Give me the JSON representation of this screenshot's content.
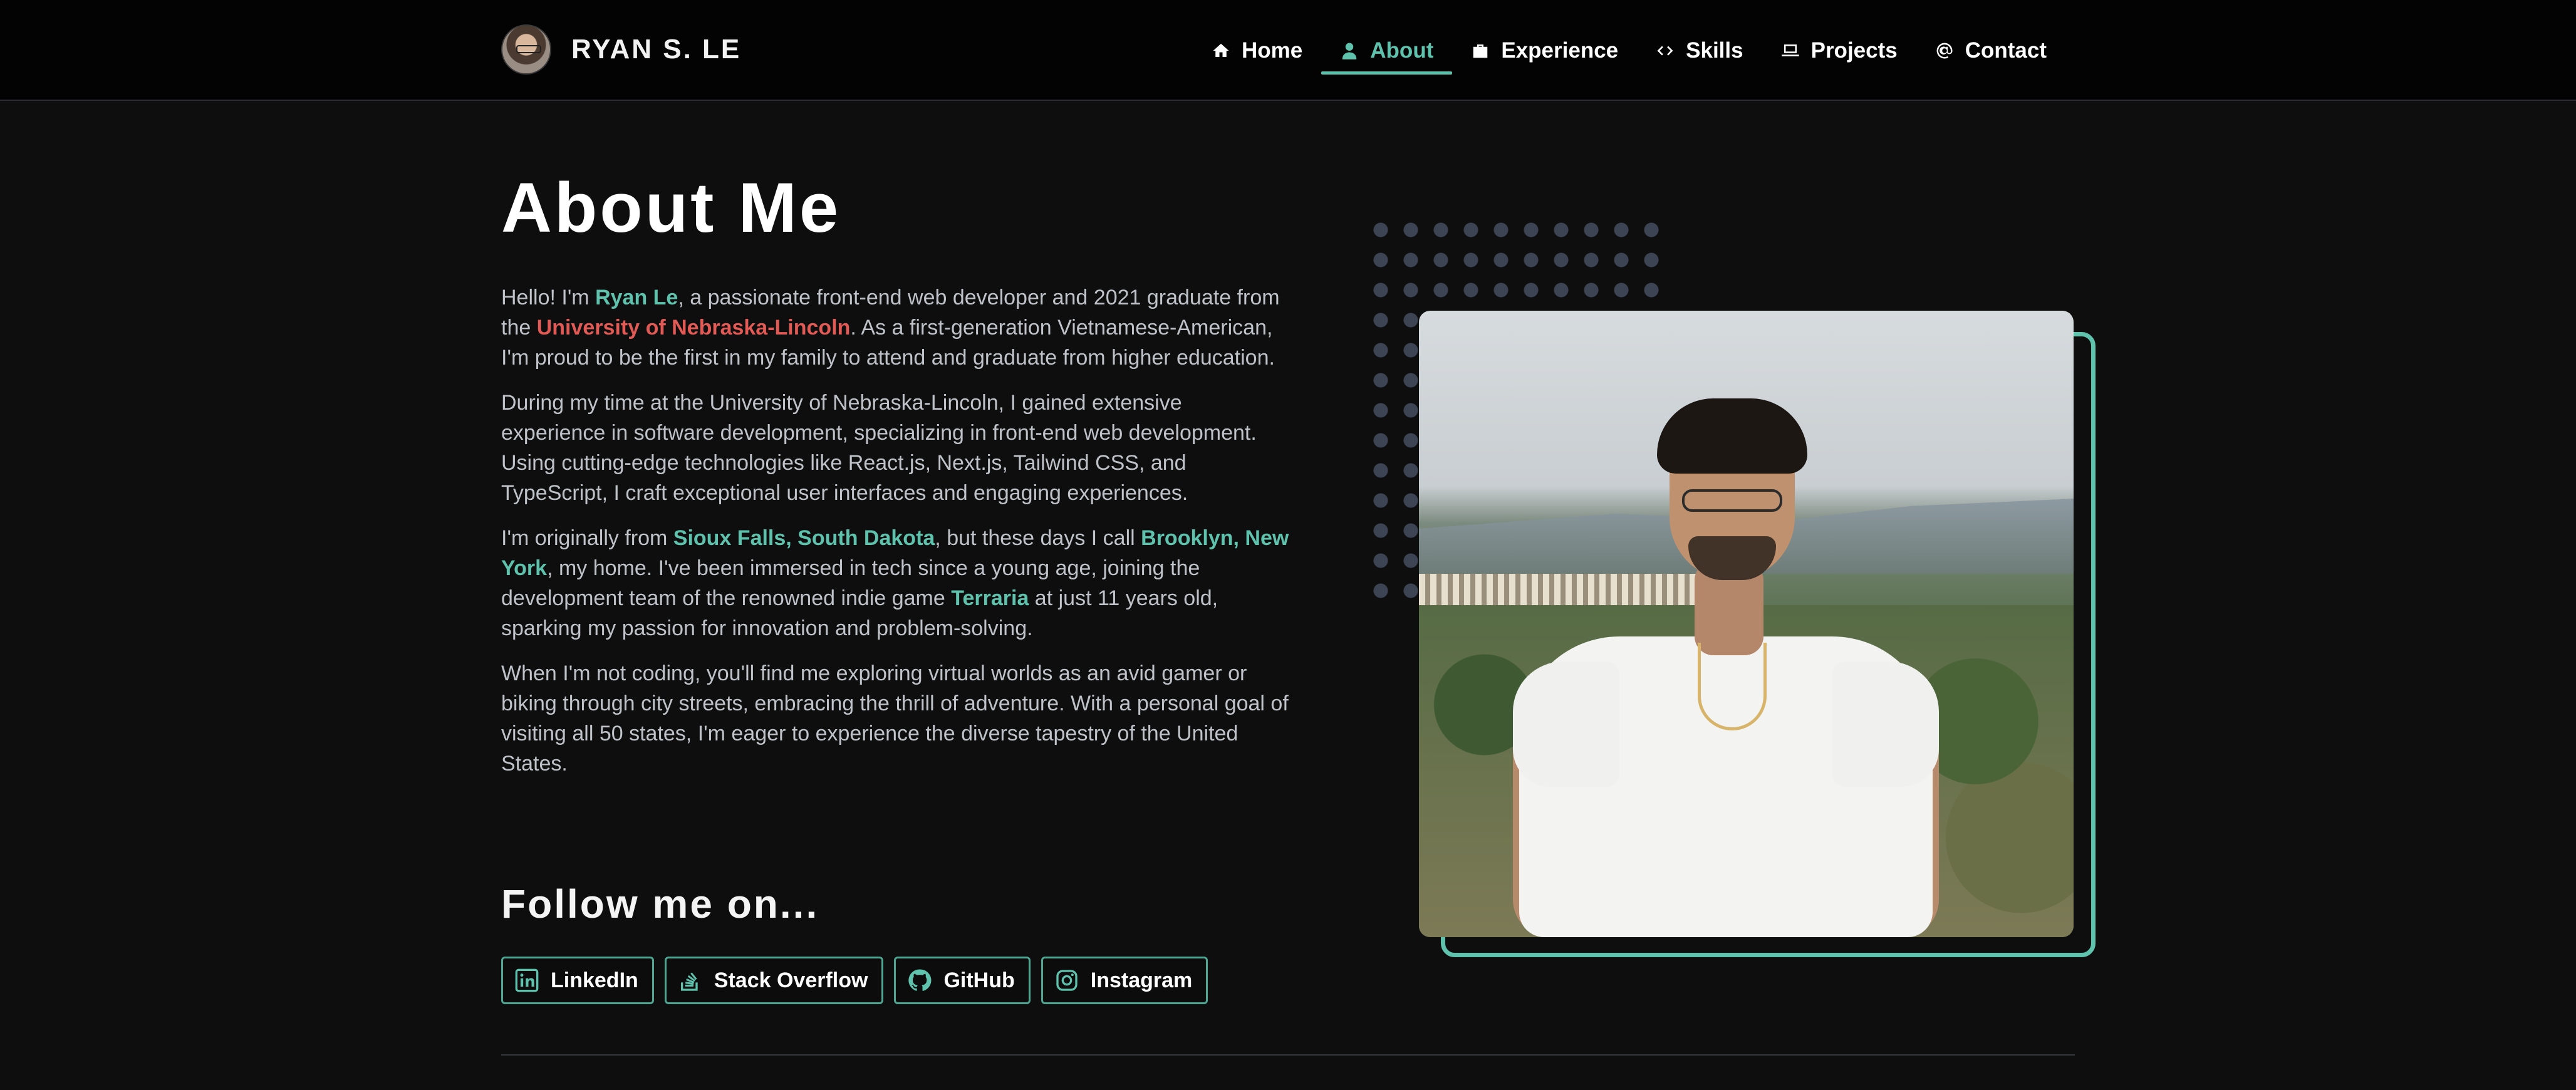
{
  "brand": {
    "name": "RYAN S. LE"
  },
  "nav": {
    "items": [
      {
        "label": "Home",
        "icon": "home-icon"
      },
      {
        "label": "About",
        "icon": "user-icon",
        "active": true
      },
      {
        "label": "Experience",
        "icon": "briefcase-icon"
      },
      {
        "label": "Skills",
        "icon": "code-icon"
      },
      {
        "label": "Projects",
        "icon": "laptop-icon"
      },
      {
        "label": "Contact",
        "icon": "at-icon"
      }
    ]
  },
  "about": {
    "title": "About Me",
    "p1": {
      "a": "Hello! I'm ",
      "name": "Ryan Le",
      "b": ", a passionate front-end web developer and 2021 graduate from the ",
      "school": "University of Nebraska-Lincoln",
      "c": ". As a first-generation Vietnamese-American, I'm proud to be the first in my family to attend and graduate from higher education."
    },
    "p2": "During my time at the University of Nebraska-Lincoln, I gained extensive experience in software development, specializing in front-end web development. Using cutting-edge technologies like React.js, Next.js, Tailwind CSS, and TypeScript, I craft exceptional user interfaces and engaging experiences.",
    "p3": {
      "a": "I'm originally from ",
      "hometown": "Sioux Falls, South Dakota",
      "b": ", but these days I call ",
      "city": "Brooklyn, New York",
      "c": ", my home. I've been immersed in tech since a young age, joining the development team of the renowned indie game ",
      "game": "Terraria",
      "d": " at just 11 years old, sparking my passion for innovation and problem-solving."
    },
    "p4": "When I'm not coding, you'll find me exploring virtual worlds as an avid gamer or biking through city streets, embracing the thrill of adventure. With a personal goal of visiting all 50 states, I'm eager to experience the diverse tapestry of the United States."
  },
  "follow": {
    "title": "Follow me on...",
    "links": [
      {
        "label": "LinkedIn",
        "icon": "linkedin-icon"
      },
      {
        "label": "Stack Overflow",
        "icon": "stackoverflow-icon"
      },
      {
        "label": "GitHub",
        "icon": "github-icon"
      },
      {
        "label": "Instagram",
        "icon": "instagram-icon"
      }
    ]
  },
  "colors": {
    "accent": "#5fc2ad",
    "school": "#e15a55",
    "background": "#0e0e0e",
    "navbar": "#030303"
  }
}
